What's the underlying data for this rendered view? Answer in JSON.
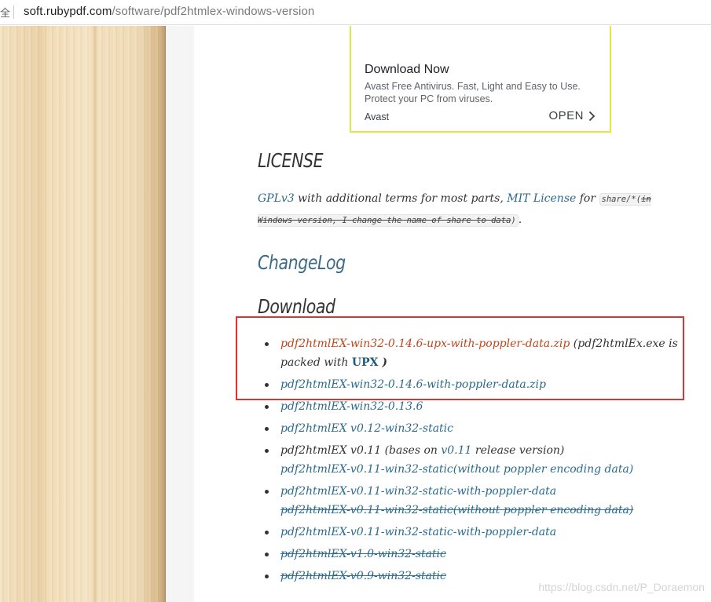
{
  "address_bar": {
    "secure_label": "全",
    "url_host": "soft.rubypdf.com",
    "url_path": "/software/pdf2htmlex-windows-version"
  },
  "ad": {
    "title": "Download Now",
    "description": "Avast Free Antivirus. Fast, Light and Easy to Use. Protect your PC from viruses.",
    "brand": "Avast",
    "cta": "OPEN",
    "border_color": "#e0e842"
  },
  "license": {
    "heading": "LICENSE",
    "gplv3": "GPLv3",
    "with_terms": " with additional terms  for most parts, ",
    "mit": "MIT License",
    "for": " for ",
    "code_path": "share/*(",
    "code_struck": "in Windows version, I change the name of share to data",
    "code_close": ")",
    "period": "."
  },
  "changelog": {
    "heading": "ChangeLog"
  },
  "download": {
    "heading": "Download",
    "items": [
      {
        "link": "pdf2htmlEX-win32-0.14.6-upx-with-poppler-data.zip",
        "note_pre": " (pdf2htmlEx.exe is packed with ",
        "upx": "UPX",
        "note_post": " )"
      },
      {
        "link": "pdf2htmlEX-win32-0.14.6-with-poppler-data.zip"
      },
      {
        "link": "pdf2htmlEX-win32-0.13.6"
      },
      {
        "link": "pdf2htmlEX v0.12-win32-static"
      },
      {
        "text_pre": "pdf2htmlEX v0.11 (bases on ",
        "inline_link": "v0.11",
        "text_post": " release version)",
        "sub_link": "pdf2htmlEX-v0.11-win32-static(without poppler encoding data)"
      },
      {
        "link": "pdf2htmlEX-v0.11-win32-static-with-poppler-data",
        "struck_link": "pdf2htmlEX-v0.11-win32-static(without poppler encoding data)"
      },
      {
        "link": "pdf2htmlEX-v0.11-win32-static-with-poppler-data"
      },
      {
        "struck_link": "pdf2htmlEX-v1.0-win32-static"
      },
      {
        "struck_link": "pdf2htmlEX-v0.9-win32-static"
      }
    ]
  },
  "watermark": "https://blog.csdn.net/P_Doraemon",
  "colors": {
    "link": "#2a6a8c",
    "visited_link": "#c0461a",
    "highlight": "#e2322e",
    "text": "#333333"
  }
}
